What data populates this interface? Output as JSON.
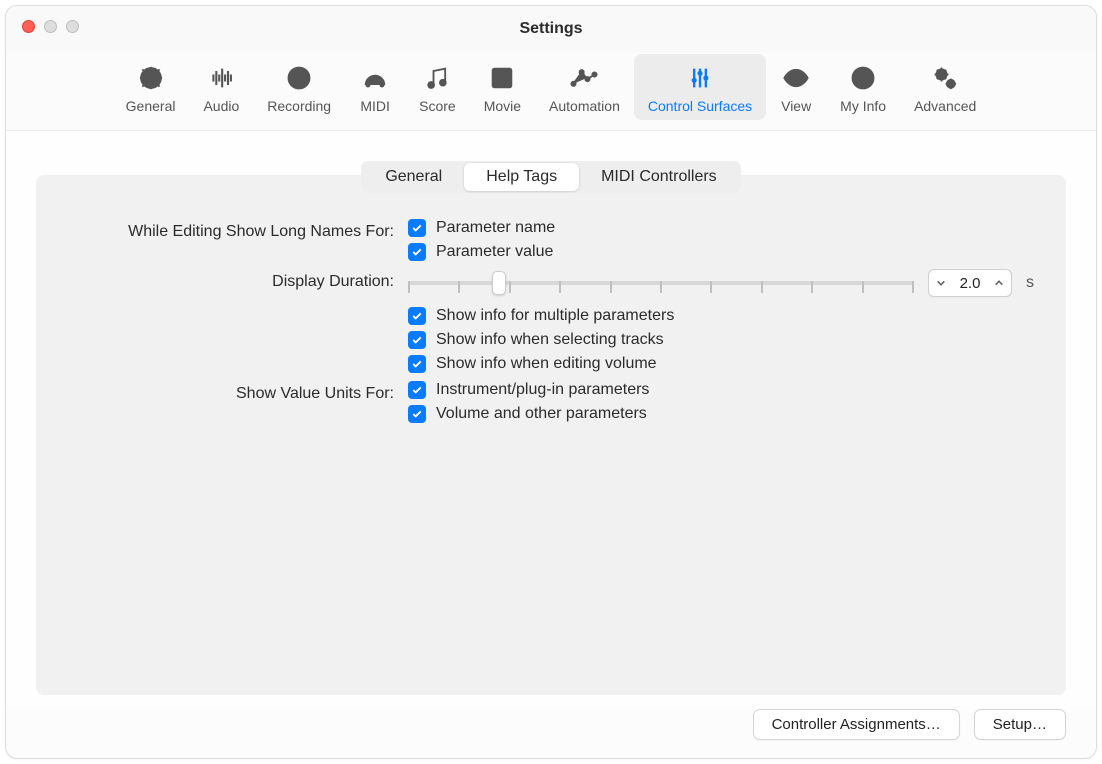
{
  "window": {
    "title": "Settings"
  },
  "toolbar": [
    {
      "id": "general",
      "label": "General",
      "active": false
    },
    {
      "id": "audio",
      "label": "Audio",
      "active": false
    },
    {
      "id": "recording",
      "label": "Recording",
      "active": false
    },
    {
      "id": "midi",
      "label": "MIDI",
      "active": false
    },
    {
      "id": "score",
      "label": "Score",
      "active": false
    },
    {
      "id": "movie",
      "label": "Movie",
      "active": false
    },
    {
      "id": "automation",
      "label": "Automation",
      "active": false
    },
    {
      "id": "control-surfaces",
      "label": "Control Surfaces",
      "active": true
    },
    {
      "id": "view",
      "label": "View",
      "active": false
    },
    {
      "id": "my-info",
      "label": "My Info",
      "active": false
    },
    {
      "id": "advanced",
      "label": "Advanced",
      "active": false
    }
  ],
  "subtabs": {
    "general": "General",
    "help_tags": "Help Tags",
    "midi_controllers": "MIDI Controllers",
    "active": "help_tags"
  },
  "labels": {
    "while_editing": "While Editing Show Long Names For:",
    "display_duration": "Display Duration:",
    "show_value_units": "Show Value Units For:"
  },
  "checkboxes": {
    "parameter_name": {
      "label": "Parameter name",
      "checked": true
    },
    "parameter_value": {
      "label": "Parameter value",
      "checked": true
    },
    "show_info_multiple": {
      "label": "Show info for multiple parameters",
      "checked": true
    },
    "show_info_selecting": {
      "label": "Show info when selecting tracks",
      "checked": true
    },
    "show_info_editing_volume": {
      "label": "Show info when editing volume",
      "checked": true
    },
    "instrument_plugin": {
      "label": "Instrument/plug-in parameters",
      "checked": true
    },
    "volume_other": {
      "label": "Volume and other parameters",
      "checked": true
    }
  },
  "display_duration": {
    "value": "2.0",
    "unit": "s"
  },
  "buttons": {
    "controller_assignments": "Controller Assignments…",
    "setup": "Setup…"
  }
}
